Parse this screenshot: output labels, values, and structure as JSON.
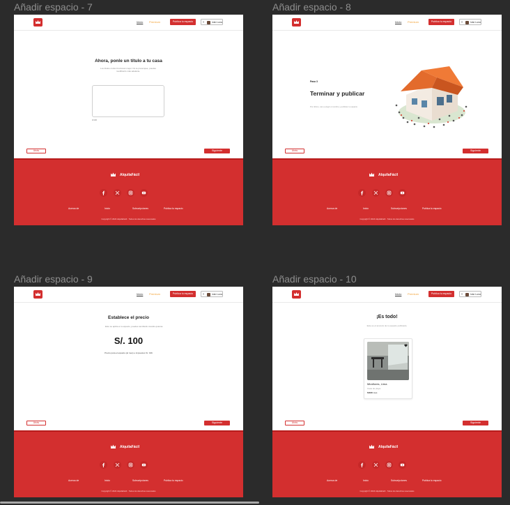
{
  "frames": [
    {
      "key": "f7",
      "title": "Añadir espacio - 7"
    },
    {
      "key": "f8",
      "title": "Añadir espacio - 8"
    },
    {
      "key": "f9",
      "title": "Añadir espacio - 9"
    },
    {
      "key": "f10",
      "title": "Añadir espacio - 10"
    }
  ],
  "header": {
    "nav_inicio": "Inicio",
    "nav_premium": "Premium",
    "publish_button": "Publica tu espacio",
    "user_name": "Iván Luna",
    "menu_icon": "hamburger-icon"
  },
  "actions": {
    "back": "Atrás",
    "next": "Siguiente"
  },
  "footer": {
    "brand": "AlquilaFácil",
    "social": [
      "facebook-icon",
      "x-icon",
      "instagram-icon",
      "youtube-icon"
    ],
    "links": [
      "Acerca de",
      "Inicio",
      "Subscripciones",
      "Publica tu espacio"
    ],
    "copyright": "Copyright © 2024 AlquilaFácil · Todos los derechos reservados"
  },
  "f7": {
    "title": "Ahora, ponle un título a tu casa",
    "subtitle": "Los títulos cortos funcionan mejor. No te preocupes, puedes modificarlo más adelante.",
    "counter": "0/100"
  },
  "f8": {
    "step": "Paso 3",
    "title": "Terminar y publicar",
    "description": "Por último, vas a elegir el nombre y publicar tu espacio."
  },
  "f9": {
    "title": "Establece el precio",
    "subtitle": "Esto se aplica a tu espacio, puedes cambiarlo cuando quieras.",
    "price": "S/. 100",
    "note": "Precio para el espacio (al mes) e impuestos S/. 196"
  },
  "f10": {
    "title": "¡Es todo!",
    "subtitle": "Este es el anuncio de tu espacio publicado.",
    "card_name": "Miraflores, Lima",
    "card_type": "Casa de playa",
    "card_price_amount": "S/100",
    "card_price_unit": "mes"
  },
  "colors": {
    "brand_red": "#d32f2f",
    "premium": "#f2a43a",
    "canvas": "#2b2b2b"
  }
}
